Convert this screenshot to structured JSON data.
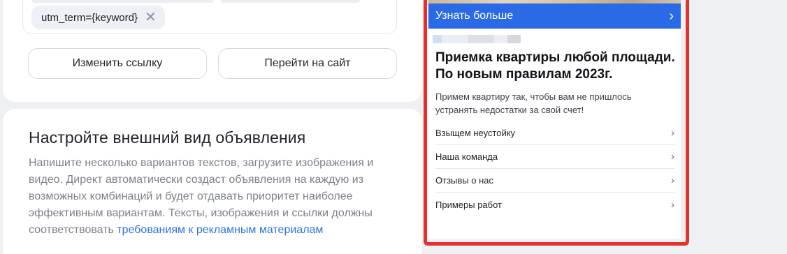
{
  "link_editor": {
    "url_param_chip": "utm_term={keyword}",
    "change_link_button": "Изменить ссылку",
    "go_to_site_button": "Перейти на сайт"
  },
  "appearance": {
    "title": "Настройте внешний вид объявления",
    "description": "Напишите несколько вариантов текстов, загрузите изображения и видео. Директ автоматически создаст объявления на каждую из возможных комбинаций и будет отдавать приоритет наиболее эффективным вариантам. Тексты, изображения и ссылки должны соответствовать ",
    "requirements_link": "требованиям к рекламным материалам"
  },
  "ad_preview": {
    "learn_more_label": "Узнать больше",
    "title": "Приемка квартиры любой площади. По новым правилам 2023г.",
    "text": "Примем квартиру так, чтобы вам не пришлось устранять недостатки за свой счет!",
    "sitelinks": [
      {
        "label": "Взыщем неустойку"
      },
      {
        "label": "Наша команда"
      },
      {
        "label": "Отзывы о нас"
      },
      {
        "label": "Примеры работ"
      }
    ],
    "highlight_color": "#e3312c",
    "button_color": "#2b6ae6"
  }
}
